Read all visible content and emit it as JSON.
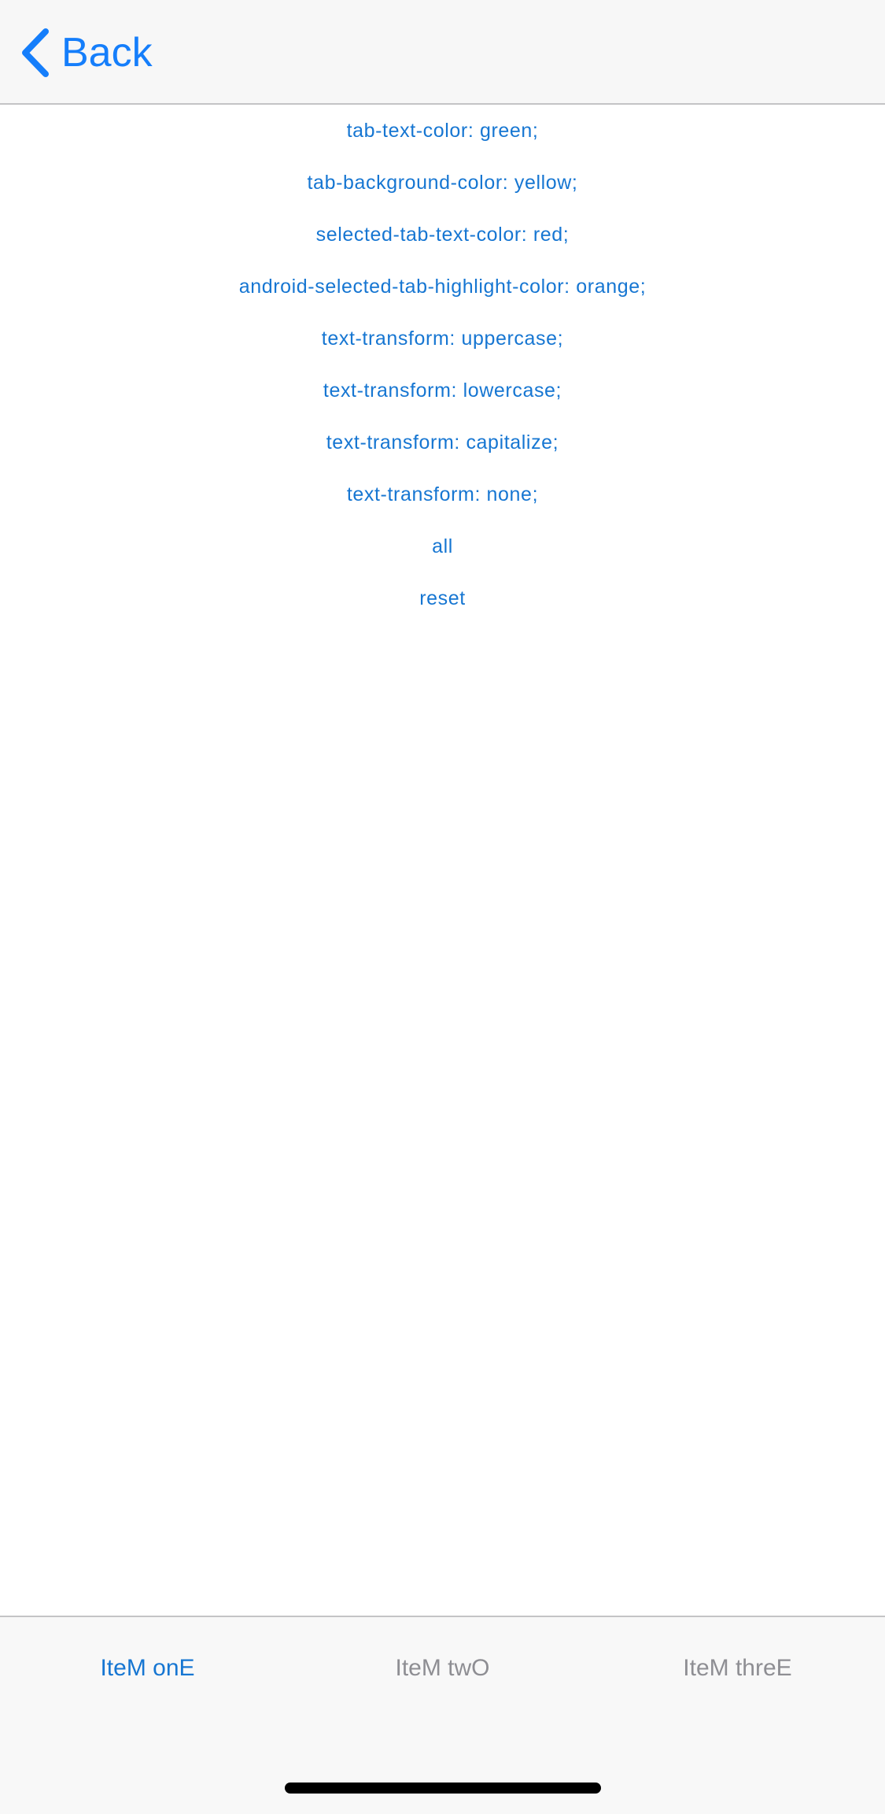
{
  "nav": {
    "back_label": "Back",
    "icon": "chevron-left-icon"
  },
  "buttons": [
    "tab-text-color: green;",
    "tab-background-color: yellow;",
    "selected-tab-text-color: red;",
    "android-selected-tab-highlight-color: orange;",
    "text-transform: uppercase;",
    "text-transform: lowercase;",
    "text-transform: capitalize;",
    "text-transform: none;",
    "all",
    "reset"
  ],
  "tabs": [
    {
      "label": "IteM onE",
      "selected": true
    },
    {
      "label": "IteM twO",
      "selected": false
    },
    {
      "label": "IteM threE",
      "selected": false
    }
  ],
  "colors": {
    "accent": "#157efb",
    "button_text": "#1676d2",
    "tab_unselected": "#8e8e93"
  }
}
